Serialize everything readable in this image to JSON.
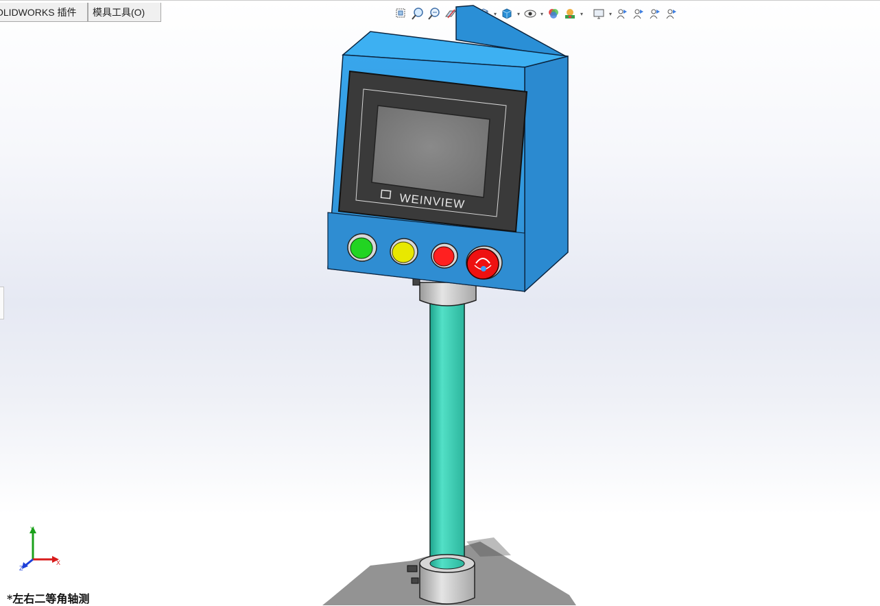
{
  "tabs": [
    {
      "label": "OLIDWORKS 插件"
    },
    {
      "label": "模具工具(O)"
    }
  ],
  "toolbar": {
    "icons": [
      "zoom-to-fit-icon",
      "zoom-area-icon",
      "previous-view-icon",
      "section-view-icon",
      "dynamic-annotation-icon",
      "view-orientation-icon",
      "display-style-icon",
      "hide-show-items-icon",
      "edit-appearance-icon",
      "apply-scene-icon",
      "view-settings-icon",
      "user-view-1-icon",
      "user-view-2-icon",
      "user-view-3-icon",
      "user-view-4-icon"
    ]
  },
  "model": {
    "brand_text": "WEINVIEW",
    "buttons": [
      {
        "name": "green-pushbutton",
        "color": "#22d422"
      },
      {
        "name": "yellow-pushbutton",
        "color": "#e8e800"
      },
      {
        "name": "red-pushbutton",
        "color": "#ff2020"
      },
      {
        "name": "emergency-stop-button",
        "color": "#ee1111"
      }
    ],
    "enclosure_color": "#2a8fd6",
    "pole_color": "#3cc9b0"
  },
  "triad": {
    "x": "X",
    "y": "Y",
    "z": "Z"
  },
  "view_label": "*左右二等角轴测"
}
